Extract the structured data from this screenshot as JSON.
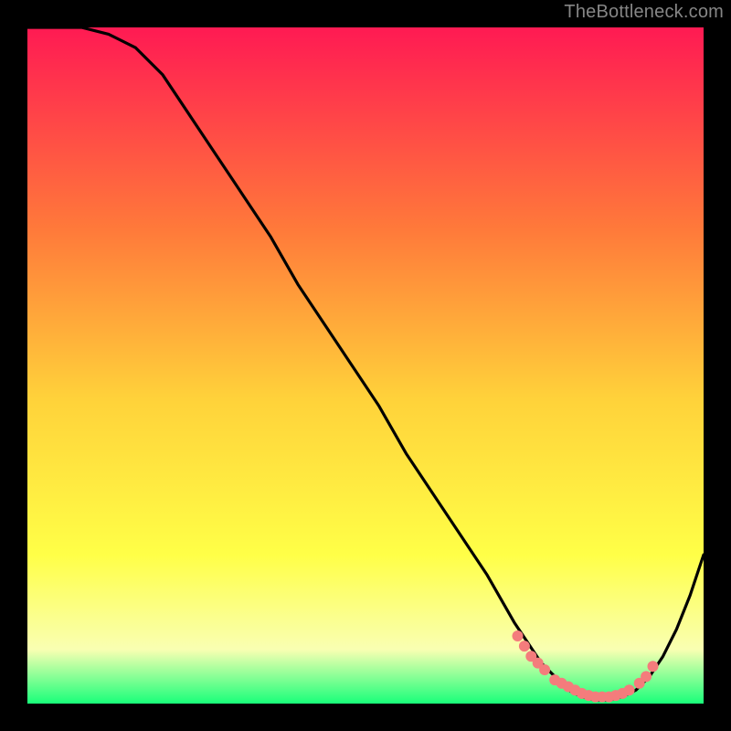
{
  "attribution": "TheBottleneck.com",
  "colors": {
    "gradient_top": "#ff1a53",
    "gradient_mid1": "#ff7a3a",
    "gradient_mid2": "#ffd23a",
    "gradient_mid3": "#ffff47",
    "gradient_mid4": "#f9ffb2",
    "gradient_bottom": "#19ff7a",
    "curve": "#000000",
    "marker": "#f47c7c"
  },
  "chart_data": {
    "type": "line",
    "title": "",
    "xlabel": "",
    "ylabel": "",
    "xlim": [
      0,
      100
    ],
    "ylim": [
      0,
      100
    ],
    "series": [
      {
        "name": "bottleneck-curve",
        "x": [
          0,
          4,
          8,
          12,
          16,
          20,
          24,
          28,
          32,
          36,
          40,
          44,
          48,
          52,
          56,
          60,
          64,
          68,
          72,
          74,
          76,
          78,
          80,
          82,
          84,
          86,
          88,
          90,
          92,
          94,
          96,
          98,
          100
        ],
        "y": [
          100,
          100,
          100,
          99,
          97,
          93,
          87,
          81,
          75,
          69,
          62,
          56,
          50,
          44,
          37,
          31,
          25,
          19,
          12,
          9,
          6,
          4,
          2,
          1,
          0.5,
          0.5,
          1,
          2,
          4,
          7,
          11,
          16,
          22
        ]
      }
    ],
    "markers": {
      "name": "highlight-points",
      "x": [
        72.5,
        73.5,
        74.5,
        75.5,
        76.5,
        78,
        79,
        80,
        81,
        82,
        83,
        84,
        85,
        86,
        87,
        88,
        89,
        90.5,
        91.5,
        92.5
      ],
      "y": [
        10,
        8.5,
        7,
        6,
        5,
        3.5,
        3,
        2.5,
        2,
        1.5,
        1.2,
        1,
        1,
        1,
        1.2,
        1.5,
        2,
        3,
        4,
        5.5
      ]
    }
  }
}
